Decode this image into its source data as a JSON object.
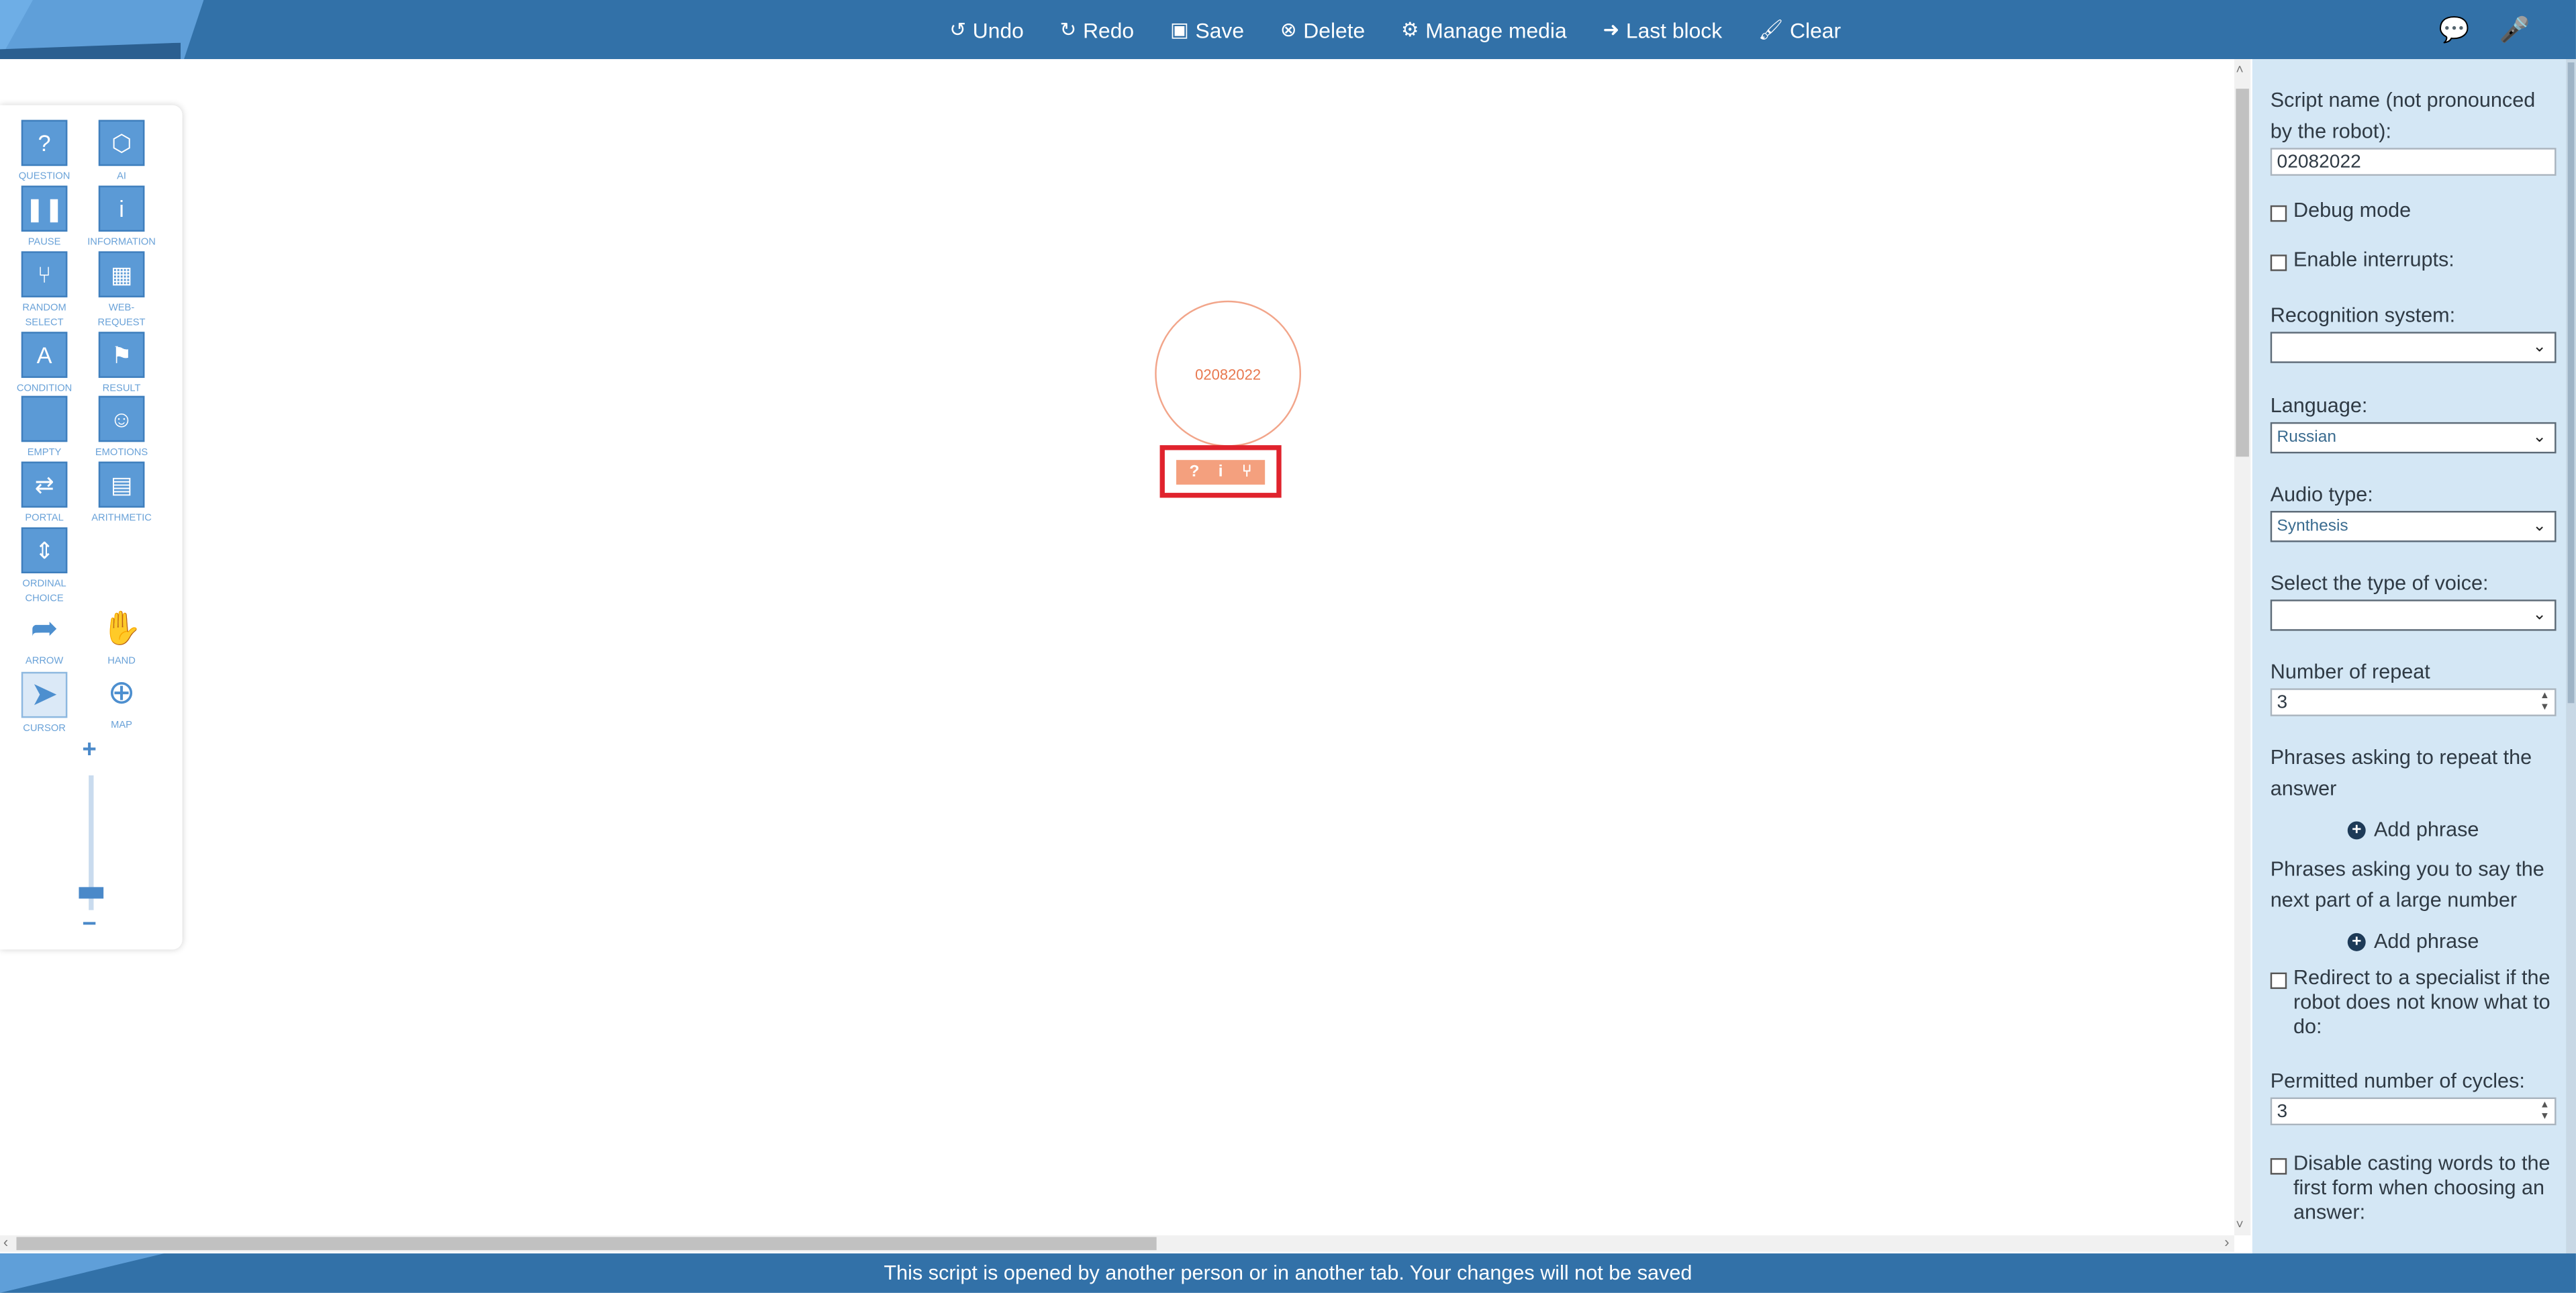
{
  "toolbar": {
    "undo": "Undo",
    "redo": "Redo",
    "save": "Save",
    "delete": "Delete",
    "manage_media": "Manage media",
    "last_block": "Last block",
    "clear": "Clear"
  },
  "top_right_icons": [
    "chat-icon",
    "microphone-icon"
  ],
  "palette": {
    "tools": [
      {
        "name": "question",
        "label": "QUESTION",
        "glyph": "?"
      },
      {
        "name": "ai",
        "label": "AI",
        "glyph": "⬡"
      },
      {
        "name": "pause",
        "label": "PAUSE",
        "glyph": "❚❚"
      },
      {
        "name": "information",
        "label": "INFORMATION",
        "glyph": "i"
      },
      {
        "name": "random-select",
        "label": "RANDOM SELECT",
        "glyph": "⑂"
      },
      {
        "name": "web-request",
        "label": "WEB-REQUEST",
        "glyph": "▦"
      },
      {
        "name": "condition",
        "label": "CONDITION",
        "glyph": "A"
      },
      {
        "name": "result",
        "label": "RESULT",
        "glyph": "⚑"
      },
      {
        "name": "empty",
        "label": "EMPTY",
        "glyph": ""
      },
      {
        "name": "emotions",
        "label": "EMOTIONS",
        "glyph": "☺"
      },
      {
        "name": "portal",
        "label": "PORTAL",
        "glyph": "⇄"
      },
      {
        "name": "arithmetic",
        "label": "ARITHMETIC",
        "glyph": "▤"
      },
      {
        "name": "ordinal-choice",
        "label": "ORDINAL CHOICE",
        "glyph": "⇕"
      },
      {
        "name": "arrow",
        "label": "ARROW",
        "glyph": "➦"
      },
      {
        "name": "hand",
        "label": "HAND",
        "glyph": "✋"
      },
      {
        "name": "cursor",
        "label": "CURSOR",
        "glyph": "➤"
      },
      {
        "name": "map",
        "label": "MAP",
        "glyph": "⊕"
      }
    ],
    "zoom_plus": "+",
    "zoom_minus": "−"
  },
  "canvas": {
    "node_label": "02082022",
    "node_tool_glyphs": [
      "?",
      "i",
      "⑂"
    ]
  },
  "settings": {
    "script_name_label": "Script name (not pronounced by the robot):",
    "script_name_value": "02082022",
    "debug_mode": "Debug mode",
    "enable_interrupts": "Enable interrupts:",
    "recognition_label": "Recognition system:",
    "recognition_value": "",
    "language_label": "Language:",
    "language_value": "Russian",
    "audio_type_label": "Audio type:",
    "audio_type_value": "Synthesis",
    "voice_label": "Select the type of voice:",
    "voice_value": "",
    "repeat_label": "Number of repeat",
    "repeat_value": "3",
    "phrases_repeat_label": "Phrases asking to repeat the answer",
    "add_phrase_1": "Add phrase",
    "phrases_next_label": "Phrases asking you to say the next part of a large number",
    "add_phrase_2": "Add phrase",
    "redirect_label": "Redirect to a specialist if the robot does not know what to do:",
    "cycles_label": "Permitted number of cycles:",
    "cycles_value": "3",
    "disable_casting_label": "Disable casting words to the first form when choosing an answer:"
  },
  "status_bar": {
    "message": "This script is opened by another person or in another tab. Your changes will not be saved"
  }
}
